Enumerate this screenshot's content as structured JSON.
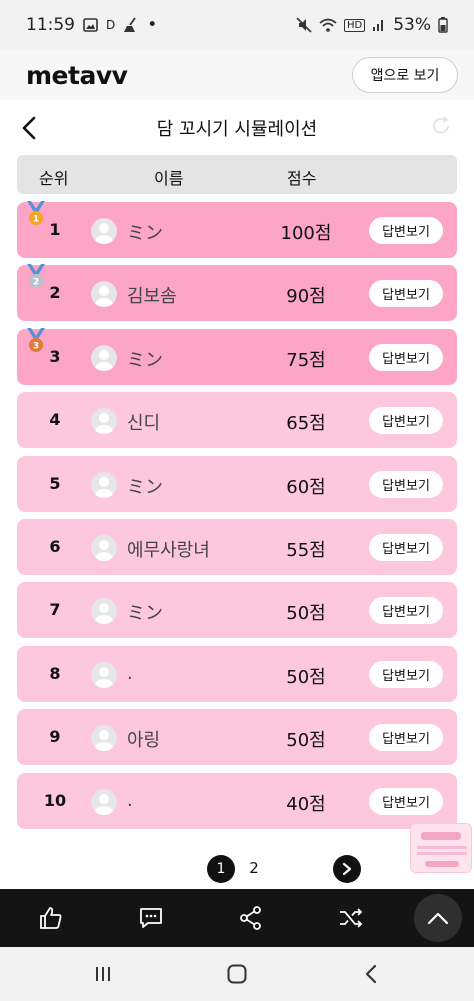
{
  "status_bar": {
    "time": "11:59",
    "indicator_d": "D",
    "dot": "•",
    "network": "HD",
    "battery": "53%"
  },
  "header": {
    "logo": "metavv",
    "open_app_label": "앱으로 보기"
  },
  "page": {
    "title": "담 꼬시기 시뮬레이션"
  },
  "table": {
    "columns": [
      "순위",
      "이름",
      "점수"
    ],
    "answer_label": "답변보기",
    "rows": [
      {
        "rank": "1",
        "name": "ミン",
        "score": "100점",
        "medal": "gold"
      },
      {
        "rank": "2",
        "name": "김보솜",
        "score": "90점",
        "medal": "silver"
      },
      {
        "rank": "3",
        "name": "ミン",
        "score": "75점",
        "medal": "bronze"
      },
      {
        "rank": "4",
        "name": "신디",
        "score": "65점",
        "medal": ""
      },
      {
        "rank": "5",
        "name": "ミン",
        "score": "60점",
        "medal": ""
      },
      {
        "rank": "6",
        "name": "에무사랑녀",
        "score": "55점",
        "medal": ""
      },
      {
        "rank": "7",
        "name": "ミン",
        "score": "50점",
        "medal": ""
      },
      {
        "rank": "8",
        "name": ".",
        "score": "50점",
        "medal": ""
      },
      {
        "rank": "9",
        "name": "아링",
        "score": "50점",
        "medal": ""
      },
      {
        "rank": "10",
        "name": ".",
        "score": "40점",
        "medal": ""
      }
    ]
  },
  "pagination": {
    "current": "1",
    "next_page": "2"
  },
  "colors": {
    "top_row": "#fca5c6",
    "other_row": "#fdc8de",
    "medal_ribbon": "#5b8fd6",
    "gold": "#f5a623",
    "silver": "#b8c2cc",
    "bronze": "#e07b39"
  },
  "icons": {
    "back": "chevron-left-icon",
    "like": "thumbs-up-icon",
    "comment": "comment-icon",
    "share": "share-icon",
    "shuffle": "shuffle-icon",
    "scroll_top": "chevron-up-icon"
  }
}
